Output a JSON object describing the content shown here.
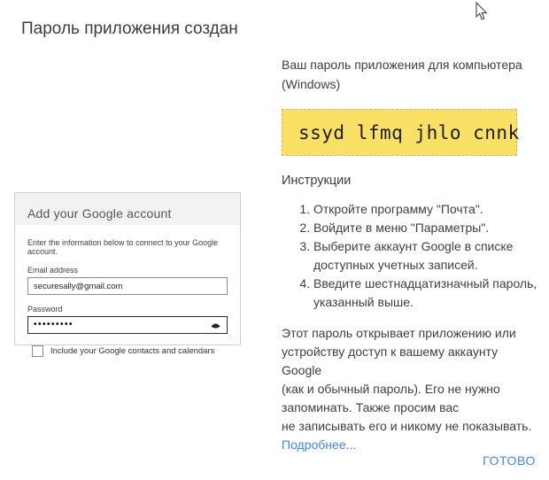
{
  "page": {
    "title": "Пароль приложения создан",
    "done_label": "ГОТОВО"
  },
  "right": {
    "password_for": "Ваш пароль приложения для компьютера\n(Windows)",
    "app_password": "ssyd lfmq jhlo cnnk",
    "instructions_title": "Инструкции",
    "steps": [
      "Откройте программу \"Почта\".",
      "Войдите в меню \"Параметры\".",
      "Выберите аккаунт Google в списке\nдоступных учетных записей.",
      "Введите шестнадцатизначный пароль,\nуказанный выше."
    ],
    "note": "Этот пароль открывает приложению или\nустройству доступ к вашему аккаунту Google\n(как и обычный пароль). Его не нужно\nзапоминать. Также просим вас\nне записывать его и никому не показывать.",
    "more_link": "Подробнее..."
  },
  "dialog": {
    "title": "Add your Google account",
    "subtitle": "Enter the information below to connect to your Google account.",
    "email_label": "Email address",
    "email_value": "securesally@gmail.com",
    "password_label": "Password",
    "password_value": "•••••••••",
    "checkbox_label": "Include your Google contacts and calendars",
    "checkbox_checked": false
  },
  "icons": {
    "cursor": "arrow-pointer",
    "reveal_password": "eye"
  },
  "colors": {
    "accent_blue": "#4285f4",
    "highlight_bg": "#fae165",
    "highlight_border": "#dfb84a",
    "text_main": "#3c4043",
    "dialog_header_bg": "#f2f2f2"
  }
}
